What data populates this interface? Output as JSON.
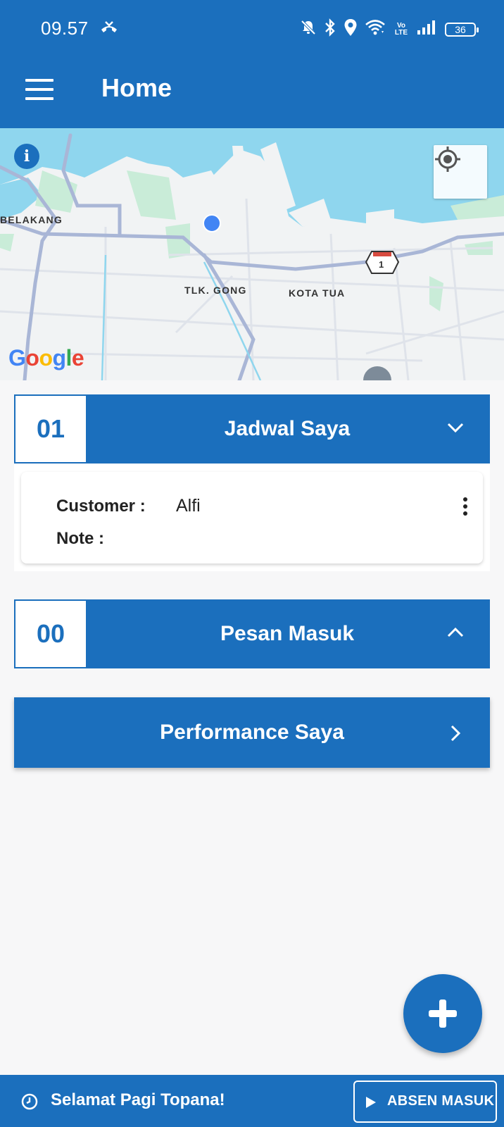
{
  "status_bar": {
    "time": "09.57",
    "battery": "36",
    "volte": "Vo LTE"
  },
  "app_bar": {
    "title": "Home"
  },
  "map": {
    "labels": {
      "belakang": "BELAKANG",
      "tlk_gong": "TLK. GONG",
      "kota_tua": "KOTA TUA",
      "route_number": "1"
    },
    "google_logo": "Google"
  },
  "sections": {
    "schedule": {
      "count": "01",
      "label": "Jadwal Saya"
    },
    "messages": {
      "count": "00",
      "label": "Pesan Masuk"
    },
    "performance": {
      "label": "Performance Saya"
    }
  },
  "schedule_card": {
    "customer_label": "Customer :",
    "customer_value": "Alfi",
    "note_label": "Note :"
  },
  "bottom_bar": {
    "greeting": "Selamat Pagi Topana!",
    "absen_label": "ABSEN MASUK"
  },
  "colors": {
    "primary": "#1b6fbd",
    "water": "#8fd6ee",
    "park": "#c9ecd8",
    "road": "#a9b6d6",
    "location_dot": "#4285f4"
  }
}
